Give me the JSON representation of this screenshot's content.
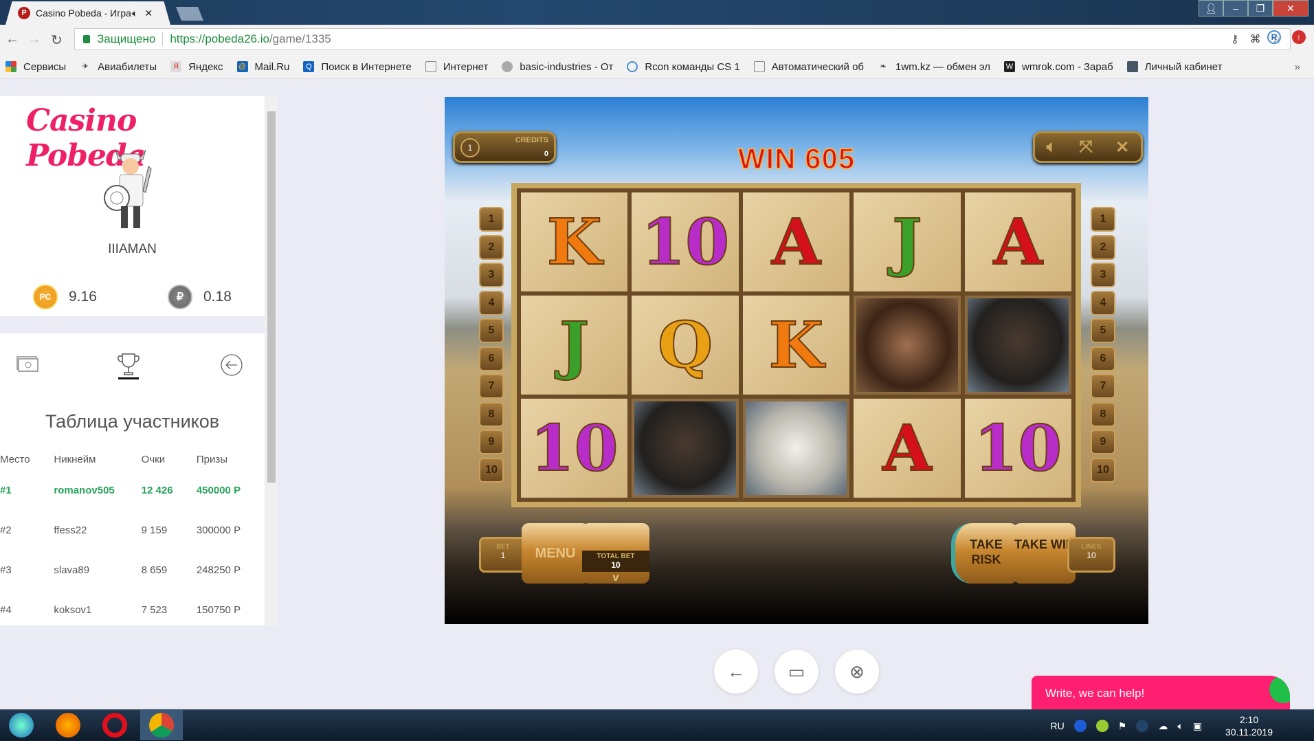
{
  "browser": {
    "tab_title": "Casino Pobeda - Игра",
    "tab_favicon": "P",
    "secure_label": "Защищено",
    "url_base": "https://pobeda26.io",
    "url_path": "/game/1335",
    "bookmarks": [
      "Сервисы",
      "Авиабилеты",
      "Яндекс",
      "Mail.Ru",
      "Поиск в Интернете",
      "Интернет",
      "basic-industries - От",
      "Rcon команды CS 1",
      "Автоматический об",
      "1wm.kz — обмен эл",
      "wmrok.com - Зараб",
      "Личный кабинет"
    ],
    "more": "»"
  },
  "sidebar": {
    "logo": "Casino Pobeda",
    "username": "IIIAMAN",
    "balance_pc": "9.16",
    "pc_label": "PC",
    "balance_rub": "0.18",
    "rub_label": "₽",
    "table_title": "Таблица участников",
    "columns": [
      "Место",
      "Никнейм",
      "Очки",
      "Призы"
    ],
    "rows": [
      [
        "#1",
        "romanov505",
        "12 426",
        "450000 Р"
      ],
      [
        "#2",
        "ffess22",
        "9 159",
        "300000 Р"
      ],
      [
        "#3",
        "slava89",
        "8 659",
        "248250 Р"
      ],
      [
        "#4",
        "koksov1",
        "7 523",
        "150750 Р"
      ]
    ]
  },
  "game": {
    "credits_label": "CREDITS",
    "credits_value": "0",
    "coin": "1",
    "win": "WIN 605",
    "reels": [
      [
        "K",
        "10",
        "A",
        "J",
        "A"
      ],
      [
        "J",
        "Q",
        "K",
        "man",
        "black-horse"
      ],
      [
        "10",
        "black-horse",
        "white-horse",
        "A",
        "10"
      ]
    ],
    "line_numbers": [
      "1",
      "2",
      "3",
      "4",
      "5",
      "6",
      "7",
      "8",
      "9",
      "10"
    ],
    "bet_label": "BET",
    "bet": "1",
    "menu": "MENU",
    "total_bet_label": "TOTAL BET",
    "total_bet": "10",
    "take_risk": "TAKE RISK",
    "take_win": "TAKE WIN",
    "lines_label": "LINES",
    "lines": "10"
  },
  "chat": {
    "label": "Write, we can help!"
  },
  "taskbar": {
    "lang": "RU",
    "time": "2:10",
    "date": "30.11.2019"
  },
  "colors": {
    "accent": "#ee2066",
    "winner": "#27a35a"
  }
}
